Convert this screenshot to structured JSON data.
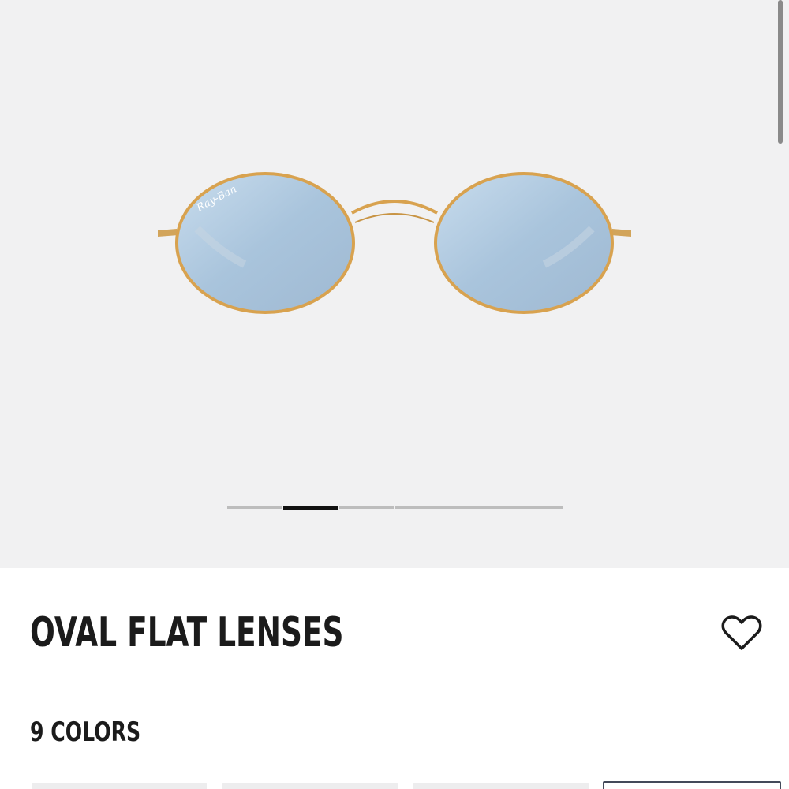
{
  "product": {
    "name": "OVAL FLAT LENSES",
    "colors_label": "9 COLORS",
    "image_icon": "sunglasses-product-image",
    "lens_logo_text": "Ray-Ban"
  },
  "gallery": {
    "slide_count": 6,
    "active_slide": 2
  },
  "wishlist": {
    "icon": "heart-icon"
  },
  "color_swatches": {
    "visible_count": 4,
    "selected_index": 4
  },
  "colors": {
    "gallery_bg": "#f1f1f2",
    "frame_gold": "#d8a24f",
    "lens_blue": "#a9c4dc",
    "text": "#1b1b1b",
    "selected_border": "#444a5a"
  }
}
